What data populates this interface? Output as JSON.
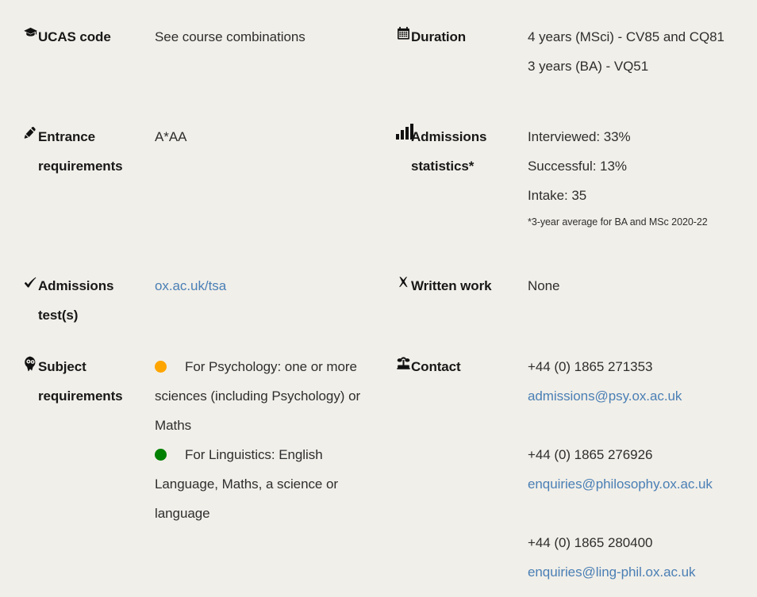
{
  "theme": {
    "background": "#f1efe9",
    "label_color": "#181818",
    "text_color": "#2e2e2e",
    "link_color": "#4a7fb5",
    "bullet_orange": "#ffa500",
    "bullet_green": "#008000"
  },
  "facts": {
    "ucas": {
      "icon": "graduation-cap-icon",
      "label": "UCAS code",
      "value": "See course combinations"
    },
    "duration": {
      "icon": "calendar-icon",
      "label": "Duration",
      "line1": "4 years (MSci) - CV85 and CQ81",
      "line2": "3 years (BA) - VQ51"
    },
    "entrance": {
      "icon": "pencil-icon",
      "label": "Entrance requirements",
      "value": "A*AA"
    },
    "admissions_stats": {
      "icon": "bar-chart-icon",
      "label": "Admissions statistics*",
      "interviewed": "Interviewed: 33%",
      "successful": "Successful: 13%",
      "intake": "Intake: 35",
      "footnote": "*3-year average for BA and MSc 2020-22"
    },
    "admissions_test": {
      "icon": "check-icon",
      "label": "Admissions test(s)",
      "link_text": "ox.ac.uk/tsa"
    },
    "written_work": {
      "icon": "cross-icon",
      "label": "Written work",
      "value": "None"
    },
    "subject_requirements": {
      "icon": "head-gears-icon",
      "label": "Subject requirements",
      "items": [
        {
          "dot_color": "orange",
          "text": "For Psychology: one or more sciences (including Psychology) or Maths"
        },
        {
          "dot_color": "green",
          "text": "For Linguistics: English Language, Maths, a science or language"
        }
      ]
    },
    "contact": {
      "icon": "telephone-icon",
      "label": "Contact",
      "entries": [
        {
          "phone": "+44 (0) 1865 271353",
          "email": "admissions@psy.ox.ac.uk"
        },
        {
          "phone": "+44 (0) 1865 276926",
          "email": "enquiries@philosophy.ox.ac.uk"
        },
        {
          "phone": "+44 (0) 1865 280400",
          "email": "enquiries@ling-phil.ox.ac.uk"
        }
      ]
    }
  }
}
